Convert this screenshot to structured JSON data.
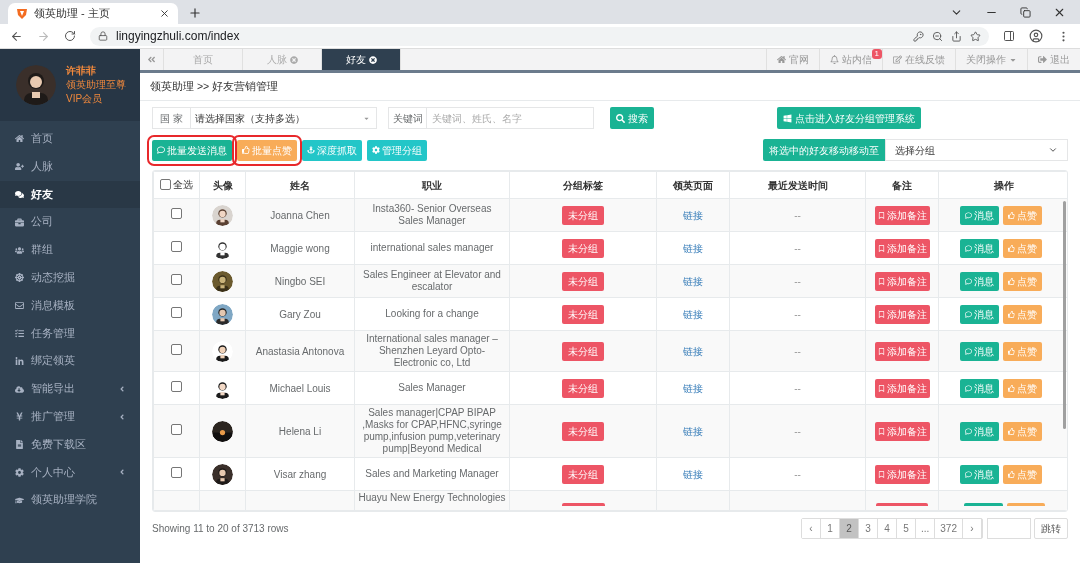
{
  "browser": {
    "tab_title": "领英助理 - 主页",
    "url": "lingyingzhuli.com/index"
  },
  "sidebar": {
    "user": {
      "name": "许菲菲",
      "level": "领英助理至尊",
      "membership": "VIP会员"
    },
    "items": [
      {
        "label": "首页",
        "selected": false,
        "expandable": false
      },
      {
        "label": "人脉",
        "selected": false,
        "expandable": false
      },
      {
        "label": "好友",
        "selected": true,
        "expandable": false
      },
      {
        "label": "公司",
        "selected": false,
        "expandable": false
      },
      {
        "label": "群组",
        "selected": false,
        "expandable": false
      },
      {
        "label": "动态挖掘",
        "selected": false,
        "expandable": false
      },
      {
        "label": "消息模板",
        "selected": false,
        "expandable": false
      },
      {
        "label": "任务管理",
        "selected": false,
        "expandable": false
      },
      {
        "label": "绑定领英",
        "selected": false,
        "expandable": false
      },
      {
        "label": "智能导出",
        "selected": false,
        "expandable": true
      },
      {
        "label": "推广管理",
        "selected": false,
        "expandable": true
      },
      {
        "label": "免费下载区",
        "selected": false,
        "expandable": false
      },
      {
        "label": "个人中心",
        "selected": false,
        "expandable": true
      },
      {
        "label": "领英助理学院",
        "selected": false,
        "expandable": false
      }
    ]
  },
  "nav_tabs": [
    {
      "label": "首页",
      "closable": false,
      "selected": false
    },
    {
      "label": "人脉",
      "closable": true,
      "selected": false
    },
    {
      "label": "好友",
      "closable": true,
      "selected": true
    }
  ],
  "top_links": [
    {
      "label": "官网",
      "dropdown": false
    },
    {
      "label": "站内信",
      "badge": "1",
      "dropdown": false
    },
    {
      "label": "在线反馈",
      "dropdown": false
    },
    {
      "label": "关闭操作",
      "dropdown": true
    },
    {
      "label": "退出",
      "dropdown": false
    }
  ],
  "breadcrumb": "领英助理 >> 好友营销管理",
  "filters": {
    "country_label": "国 家",
    "country_value": "请选择国家（支持多选）",
    "keyword_label": "关键词",
    "keyword_placeholder": "关键词、姓氏、名字",
    "search_button": "搜索",
    "group_system_button": "点击进入好友分组管理系统"
  },
  "actions": [
    {
      "label": "批量发送消息",
      "color": "#1ab394",
      "highlighted": true
    },
    {
      "label": "批量点赞",
      "color": "#f8ac59",
      "highlighted": true
    },
    {
      "label": "深度抓取",
      "color": "#23c6c8",
      "highlighted": false
    },
    {
      "label": "管理分组",
      "color": "#23c6c8",
      "highlighted": false
    }
  ],
  "move_group": {
    "label": "将选中的好友移动移动至",
    "select_value": "选择分组"
  },
  "table": {
    "select_all": {
      "label": "全选",
      "checked": false
    },
    "columns": [
      "头像",
      "姓名",
      "职业",
      "分组标签",
      "领英页面",
      "最近发送时间",
      "备注",
      "操作"
    ],
    "rows": [
      {
        "kind": "full",
        "checked": false,
        "name": "Joanna Chen",
        "occupation": "Insta360- Senior Overseas Sales Manager",
        "tag": "未分组",
        "link": "链接",
        "last_sent": "--",
        "note_button": "添加备注",
        "message_button": "消息",
        "like_button": "点赞"
      },
      {
        "kind": "full",
        "checked": false,
        "name": "Maggie wong",
        "occupation": "international sales manager",
        "tag": "未分组",
        "link": "链接",
        "last_sent": "--",
        "note_button": "添加备注",
        "message_button": "消息",
        "like_button": "点赞"
      },
      {
        "kind": "full",
        "checked": false,
        "name": "Ningbo SEI",
        "occupation": "Sales Engineer at Elevator and escalator",
        "tag": "未分组",
        "link": "链接",
        "last_sent": "--",
        "note_button": "添加备注",
        "message_button": "消息",
        "like_button": "点赞"
      },
      {
        "kind": "full",
        "checked": false,
        "name": "Gary Zou",
        "occupation": "Looking for a change",
        "tag": "未分组",
        "link": "链接",
        "last_sent": "--",
        "note_button": "添加备注",
        "message_button": "消息",
        "like_button": "点赞"
      },
      {
        "kind": "full",
        "checked": false,
        "name": "Anastasia Antonova",
        "occupation": "International sales manager – Shenzhen Leyard Opto-Electronic co, Ltd",
        "tag": "未分组",
        "link": "链接",
        "last_sent": "--",
        "note_button": "添加备注",
        "message_button": "消息",
        "like_button": "点赞"
      },
      {
        "kind": "full",
        "checked": false,
        "name": "Michael Louis",
        "occupation": "Sales Manager",
        "tag": "未分组",
        "link": "链接",
        "last_sent": "--",
        "note_button": "添加备注",
        "message_button": "消息",
        "like_button": "点赞"
      },
      {
        "kind": "full",
        "checked": false,
        "name": "Helena Li",
        "occupation": "Sales manager|CPAP BIPAP ,Masks for CPAP,HFNC,syringe pump,infusion pump,veterinary pump|Beyond Medical",
        "tag": "未分组",
        "link": "链接",
        "last_sent": "--",
        "note_button": "添加备注",
        "message_button": "消息",
        "like_button": "点赞"
      },
      {
        "kind": "full",
        "checked": false,
        "name": "Visar zhang",
        "occupation": "Sales and Marketing Manager",
        "tag": "未分组",
        "link": "链接",
        "last_sent": "--",
        "note_button": "添加备注",
        "message_button": "消息",
        "like_button": "点赞"
      },
      {
        "kind": "partial",
        "occupation": "Huayu New Energy Technologies"
      }
    ]
  },
  "footer": {
    "summary": "Showing 11 to 20 of 3713 rows",
    "pages": [
      {
        "label": "‹",
        "selected": false
      },
      {
        "label": "1",
        "selected": false
      },
      {
        "label": "2",
        "selected": true
      },
      {
        "label": "3",
        "selected": false
      },
      {
        "label": "4",
        "selected": false
      },
      {
        "label": "5",
        "selected": false
      },
      {
        "label": "...",
        "selected": false
      },
      {
        "label": "372",
        "selected": false
      },
      {
        "label": "›",
        "selected": false
      }
    ],
    "go_button": "跳转"
  }
}
